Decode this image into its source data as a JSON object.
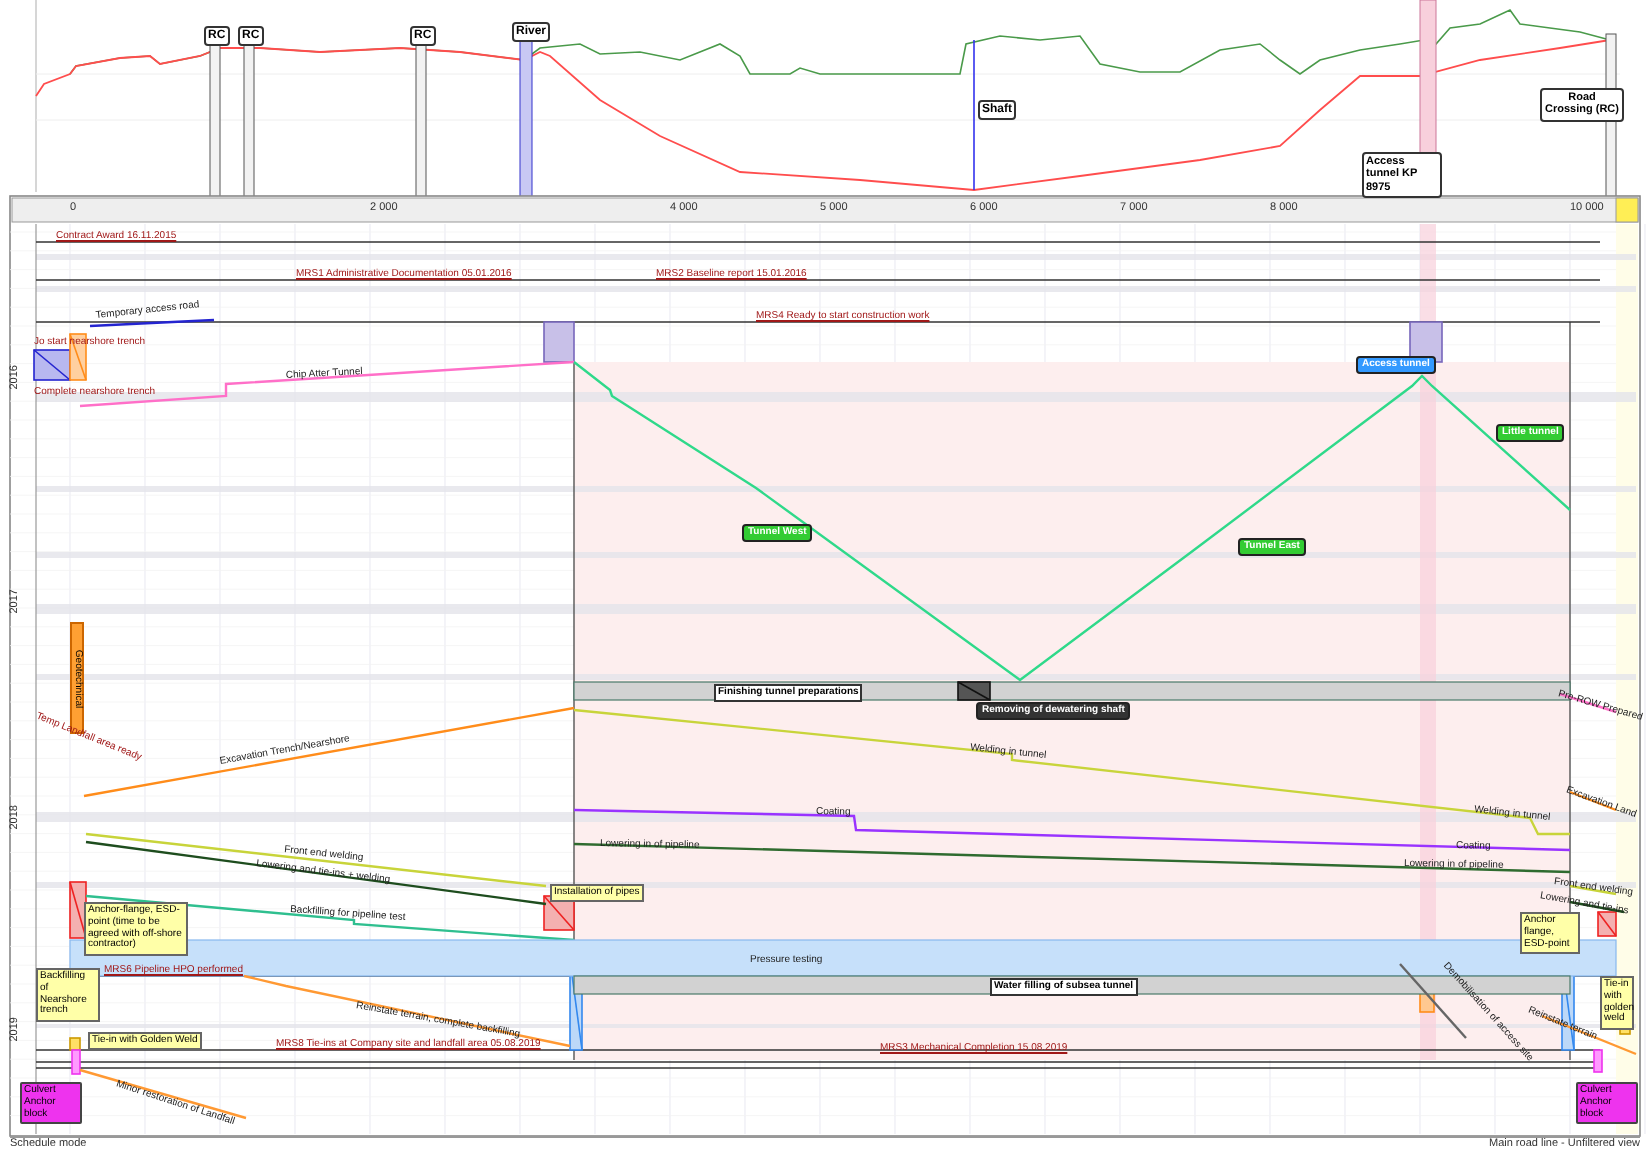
{
  "profile": {
    "markers": [
      {
        "label": "RC",
        "kind": "crossing"
      },
      {
        "label": "RC",
        "kind": "crossing"
      },
      {
        "label": "RC",
        "kind": "crossing"
      },
      {
        "label": "River",
        "kind": "river"
      },
      {
        "label": "Shaft",
        "kind": "shaft"
      },
      {
        "label": "Access tunnel KP 8975",
        "kind": "access"
      },
      {
        "label": "Road Crossing (RC)",
        "kind": "crossing"
      }
    ]
  },
  "distance_axis": {
    "ticks": [
      "0",
      "2 000",
      "4 000",
      "5 000",
      "6 000",
      "7 000",
      "8 000",
      "10 000"
    ]
  },
  "time_axis": {
    "years": [
      "2016",
      "2017",
      "2018",
      "2019"
    ]
  },
  "milestones": [
    {
      "label": "Contract Award 16.11.2015"
    },
    {
      "label": "MRS1 Administrative Documentation 05.01.2016"
    },
    {
      "label": "MRS2 Baseline report 15.01.2016"
    },
    {
      "label": "MRS4 Ready to start construction work"
    },
    {
      "label": "MRS6 Pipeline HPO performed"
    },
    {
      "label": "MRS8 Tie-ins at Company site and landfall area 05.08.2019"
    },
    {
      "label": "MRS3 Mechanical Completion 15.08.2019"
    }
  ],
  "activities": [
    {
      "kind": "line",
      "color": "#2424d0",
      "labels": [
        "Temporary access road"
      ]
    },
    {
      "kind": "text",
      "labels": [
        "Jo start nearshore trench"
      ]
    },
    {
      "kind": "text",
      "labels": [
        "Complete nearshore trench"
      ]
    },
    {
      "kind": "line",
      "color": "#ff6fc8",
      "labels": [
        "Chip Atter Tunnel"
      ]
    },
    {
      "kind": "line",
      "color": "#2fd98a"
    },
    {
      "kind": "tag",
      "color": "#33cc33",
      "labels": [
        "Tunnel West"
      ]
    },
    {
      "kind": "tag",
      "color": "#33cc33",
      "labels": [
        "Tunnel East"
      ]
    },
    {
      "kind": "tag",
      "color": "#3399ff",
      "labels": [
        "Access tunnel"
      ]
    },
    {
      "kind": "tag",
      "color": "#33cc33",
      "labels": [
        "Little tunnel"
      ]
    },
    {
      "kind": "vtag",
      "color": "#ffa033",
      "labels": [
        "Geotechnical"
      ]
    },
    {
      "kind": "text",
      "labels": [
        "Temp Landfall area ready"
      ]
    },
    {
      "kind": "bar",
      "labels": [
        "Finishing tunnel preparations"
      ]
    },
    {
      "kind": "tag",
      "color": "#333333",
      "labels": [
        "Removing of dewatering shaft"
      ]
    },
    {
      "kind": "line",
      "color": "#ff8c1a",
      "labels": [
        "Excavation Trench/Nearshore"
      ]
    },
    {
      "kind": "line",
      "color": "#ff6fc8",
      "labels": [
        "Pre-ROW Prepared"
      ]
    },
    {
      "kind": "line",
      "color": "#c8d43a",
      "labels": [
        "Welding in tunnel",
        "Welding in tunnel"
      ]
    },
    {
      "kind": "line",
      "color": "#ff8c1a",
      "labels": [
        "Excavation Land"
      ]
    },
    {
      "kind": "line",
      "color": "#9933ff",
      "labels": [
        "Coating",
        "Coating"
      ]
    },
    {
      "kind": "line",
      "color": "#2f6b2f",
      "labels": [
        "Lowering in of pipeline",
        "Lowering in of pipeline"
      ]
    },
    {
      "kind": "line",
      "color": "#c8d43a",
      "labels": [
        "Front end welding"
      ]
    },
    {
      "kind": "line",
      "color": "#1e4d1e",
      "labels": [
        "Lowering and tie-ins + welding"
      ]
    },
    {
      "kind": "line",
      "color": "#2fbf8f",
      "labels": [
        "Backfilling for pipeline test"
      ]
    },
    {
      "kind": "note",
      "labels": [
        "Anchor-flange, ESD-point (time to be agreed with off-shore contractor)"
      ]
    },
    {
      "kind": "note",
      "labels": [
        "Installation of pipes"
      ]
    },
    {
      "kind": "line",
      "color": "#c8d43a",
      "labels": [
        "Front end welding"
      ]
    },
    {
      "kind": "line",
      "color": "#1e4d1e",
      "labels": [
        "Lowering and tie-ins"
      ]
    },
    {
      "kind": "note",
      "labels": [
        "Anchor flange, ESD-point"
      ]
    },
    {
      "kind": "band",
      "labels": [
        "Pressure testing"
      ]
    },
    {
      "kind": "note",
      "labels": [
        "Backfilling of Nearshore trench"
      ]
    },
    {
      "kind": "bar",
      "labels": [
        "Water filling of subsea tunnel"
      ]
    },
    {
      "kind": "line",
      "color": "#ff9933",
      "labels": [
        "Reinstate terrain, complete backfilling"
      ]
    },
    {
      "kind": "line",
      "color": "#666666",
      "labels": [
        "Demobilisation of access site"
      ]
    },
    {
      "kind": "note",
      "labels": [
        "Tie-in with golden weld"
      ]
    },
    {
      "kind": "line",
      "color": "#ff9933",
      "labels": [
        "Reinstate terrain"
      ]
    },
    {
      "kind": "note",
      "labels": [
        "Tie-in with Golden Weld"
      ]
    },
    {
      "kind": "tag",
      "color": "#ee33ee",
      "labels": [
        "Culvert Anchor block"
      ]
    },
    {
      "kind": "line",
      "color": "#ff9933",
      "labels": [
        "Minor restoration of Landfall"
      ]
    },
    {
      "kind": "tag",
      "color": "#ee33ee",
      "labels": [
        "Culvert Anchor block"
      ]
    }
  ],
  "status_bar": {
    "left": "Schedule mode",
    "right": "Main road line - Unfiltered view"
  }
}
